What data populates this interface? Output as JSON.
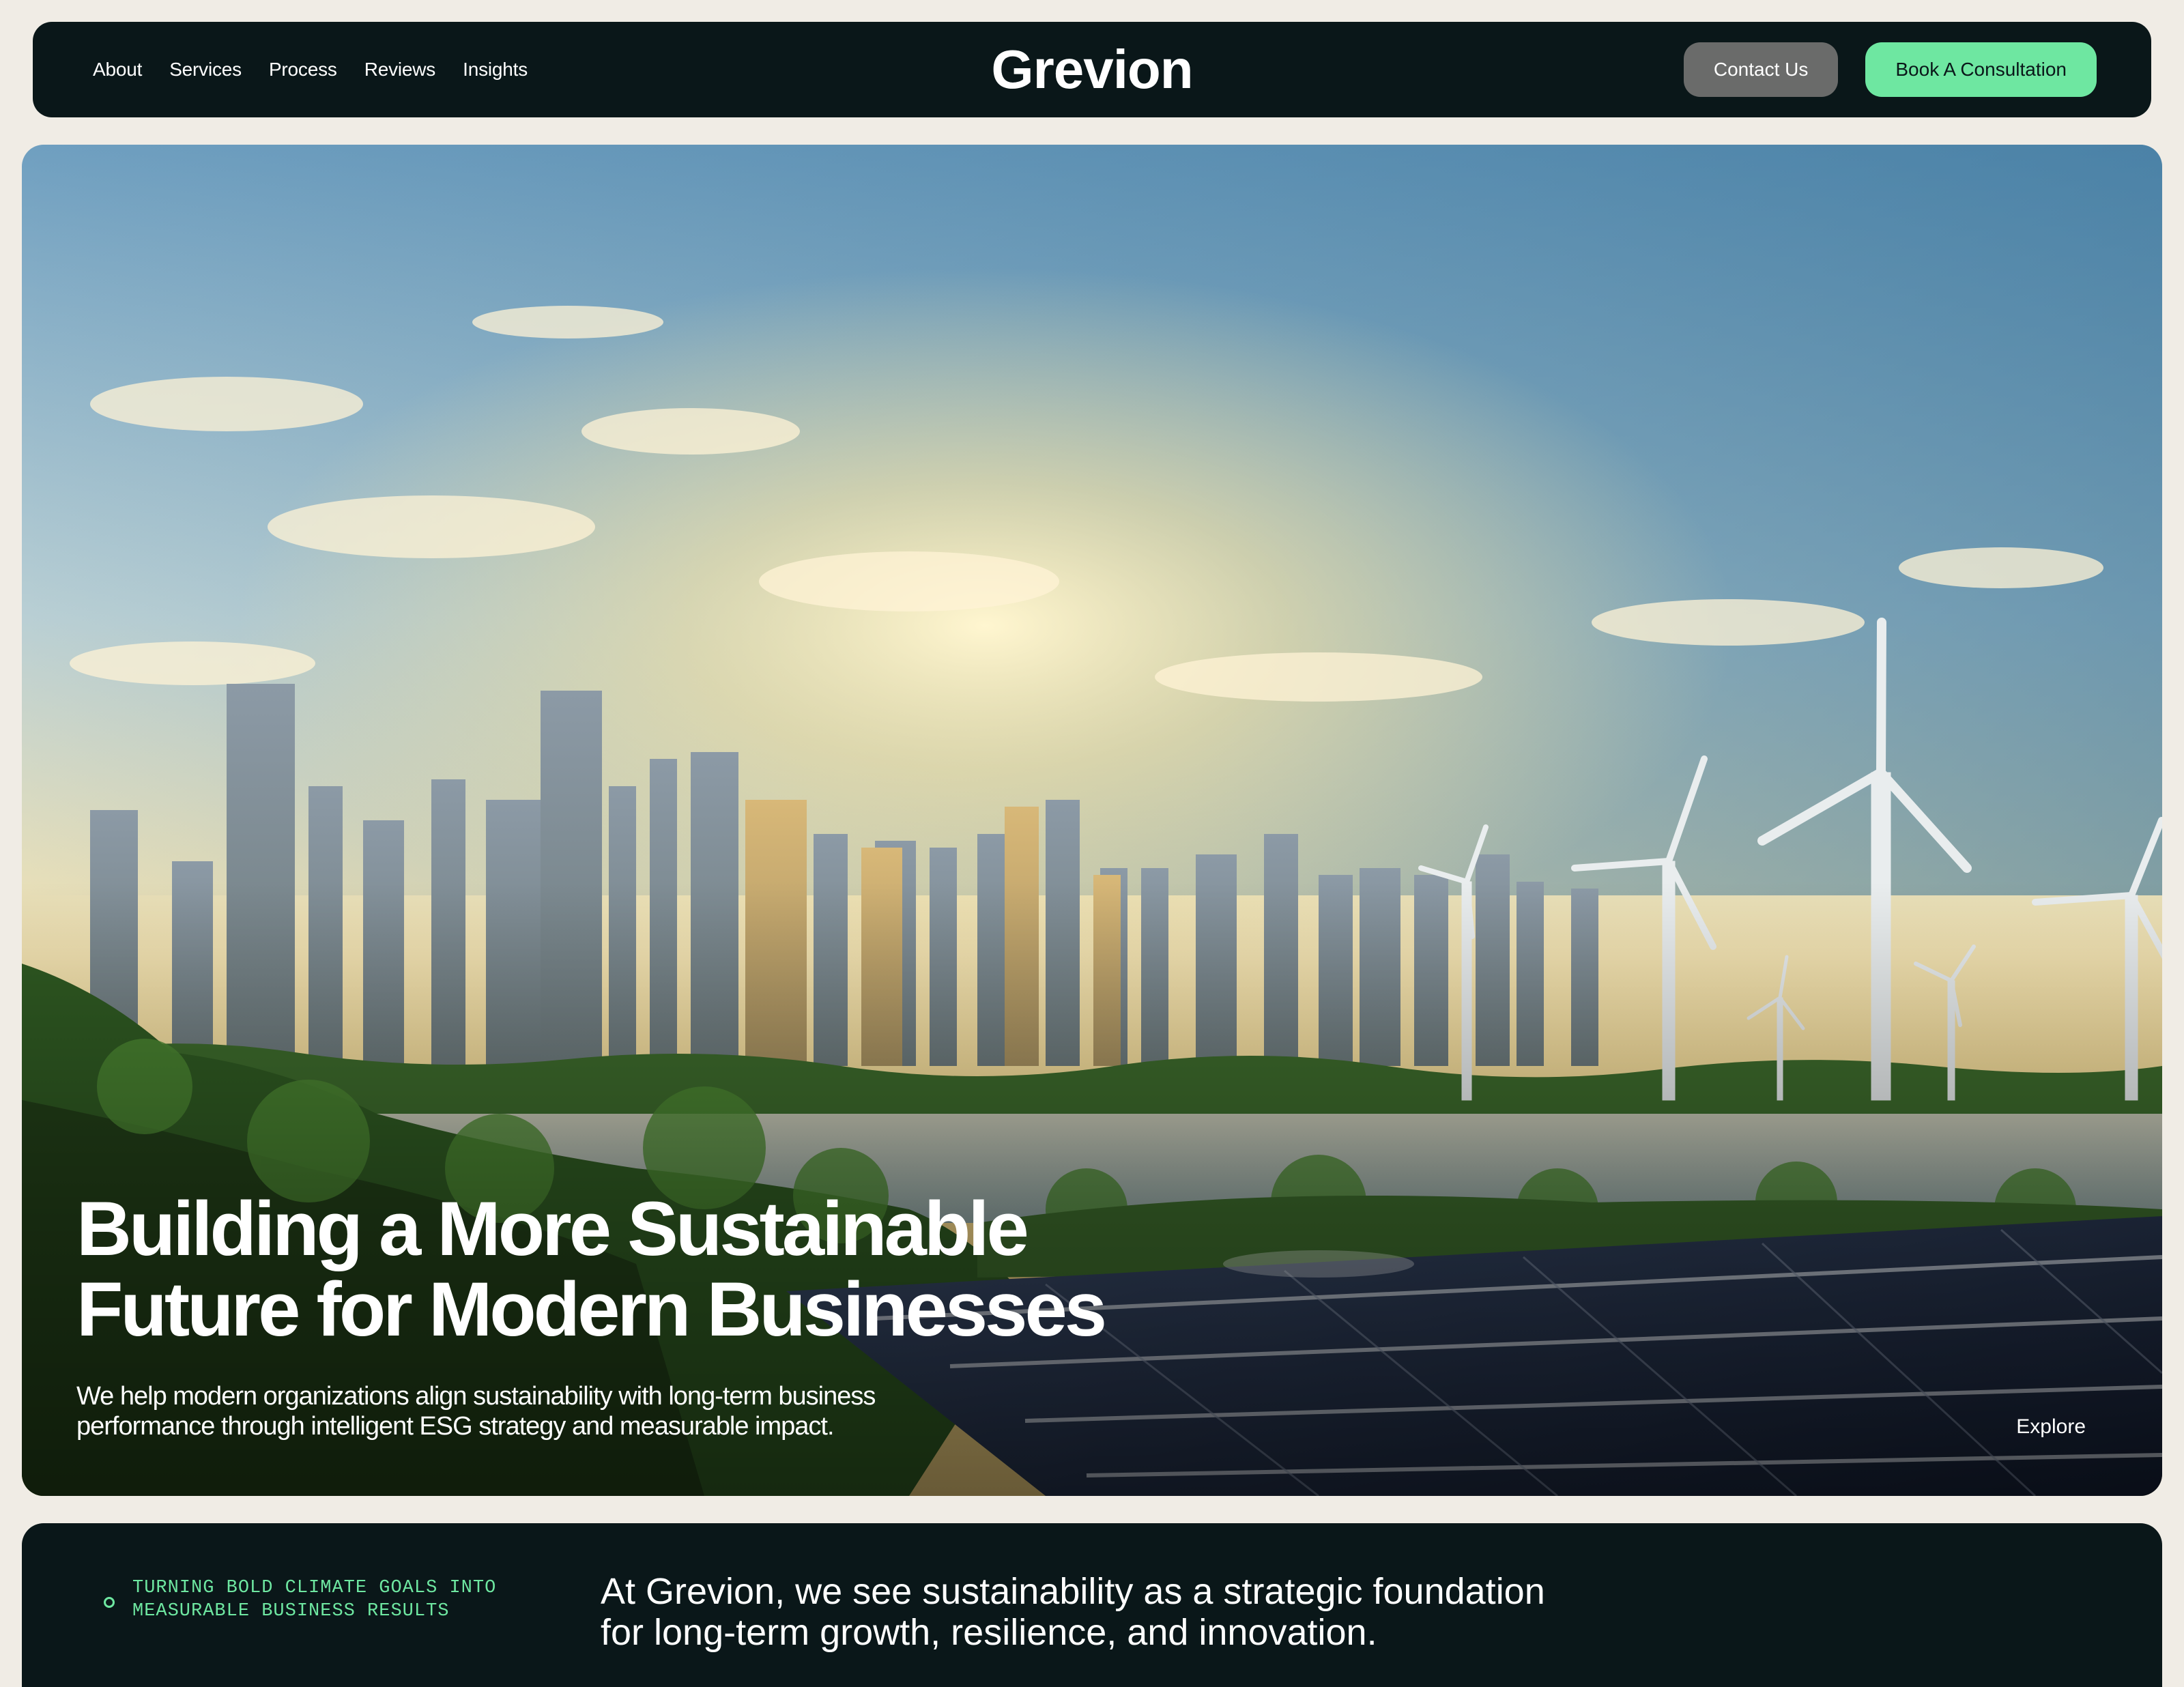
{
  "nav": {
    "links": [
      "About",
      "Services",
      "Process",
      "Reviews",
      "Insights"
    ],
    "brand": "Grevion",
    "contact_label": "Contact Us",
    "book_label": "Book A Consultation"
  },
  "hero": {
    "title_line1": "Building a More Sustainable",
    "title_line2": "Future for Modern Businesses",
    "subtitle_line1": "We help modern organizations align sustainability with long-term business",
    "subtitle_line2": "performance through intelligent ESG strategy and measurable impact.",
    "explore_label": "Explore",
    "image_alt": "City skyline with wind turbines, lake and solar panels at sunset"
  },
  "about": {
    "tagline_line1": "TURNING BOLD CLIMATE GOALS INTO",
    "tagline_line2": "MEASURABLE BUSINESS RESULTS",
    "statement_line1": "At Grevion, we see sustainability as a strategic foundation",
    "statement_line2": "for long-term growth, resilience, and innovation."
  },
  "colors": {
    "dark": "#0a1719",
    "accent": "#6ee7a1",
    "page_bg": "#f0ece5",
    "contact_bg": "#6a6b6a"
  }
}
